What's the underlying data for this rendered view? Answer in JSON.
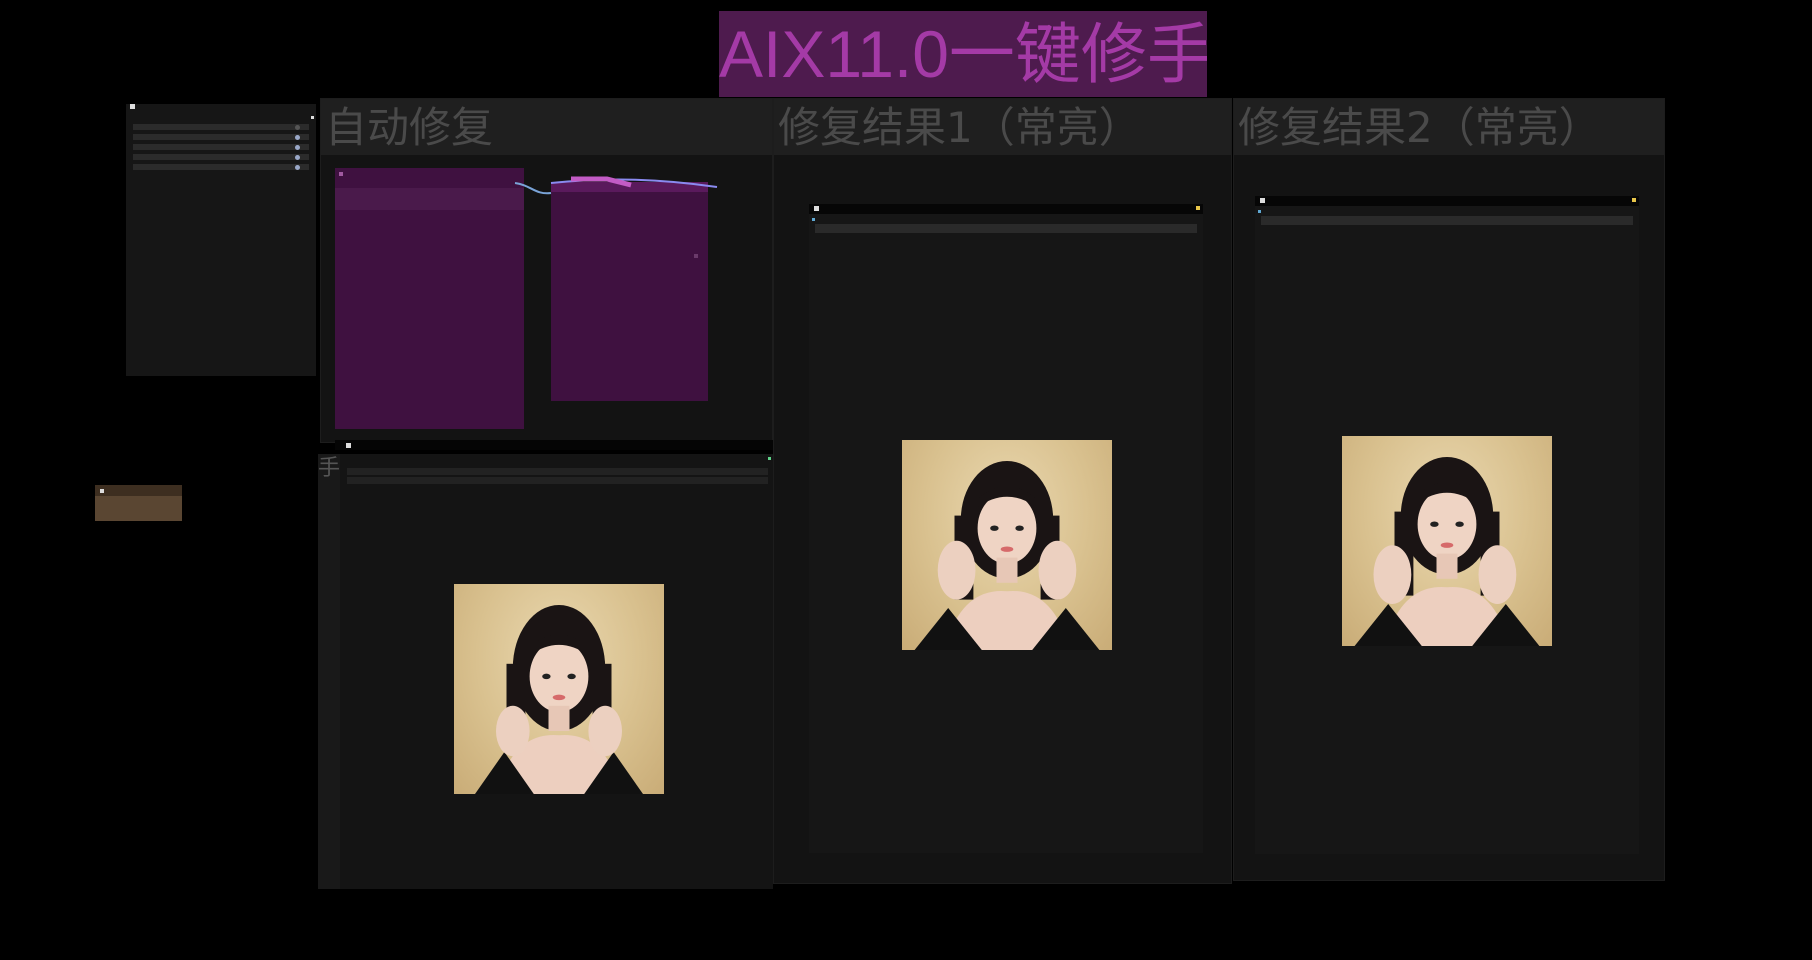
{
  "banner": {
    "title": "AIX11.0一键修手"
  },
  "groups": {
    "auto_repair": {
      "title": "自动修复"
    },
    "result1": {
      "title": "修复结果1（常亮）"
    },
    "result2": {
      "title": "修复结果2（常亮）"
    }
  },
  "preview_node": {
    "title_glyph": "手"
  },
  "colors": {
    "background": "#000000",
    "banner_bg": "#4e1b4e",
    "banner_text": "#a43aa6",
    "group_header": "#1f1f1f",
    "node_purple": "#3f1140",
    "note_node": "#5a4632"
  }
}
